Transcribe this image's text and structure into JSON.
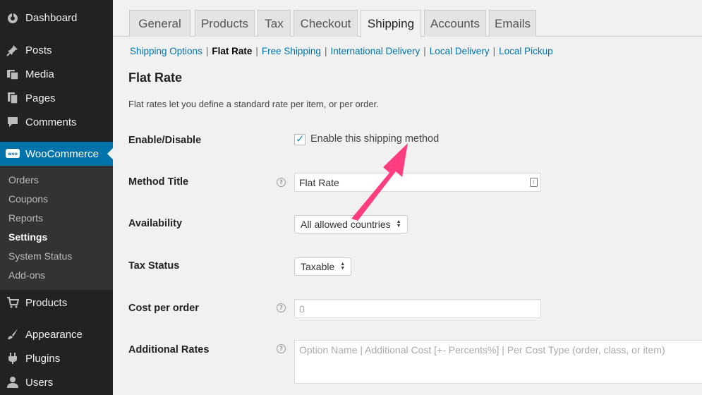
{
  "sidebar": {
    "items": [
      {
        "label": "Dashboard",
        "icon": "dashboard-icon"
      },
      {
        "label": "Posts",
        "icon": "pin-icon"
      },
      {
        "label": "Media",
        "icon": "media-icon"
      },
      {
        "label": "Pages",
        "icon": "pages-icon"
      },
      {
        "label": "Comments",
        "icon": "comments-icon"
      },
      {
        "label": "WooCommerce",
        "icon": "woo-icon"
      },
      {
        "label": "Products",
        "icon": "cart-icon"
      },
      {
        "label": "Appearance",
        "icon": "brush-icon"
      },
      {
        "label": "Plugins",
        "icon": "plug-icon"
      },
      {
        "label": "Users",
        "icon": "user-icon"
      }
    ],
    "submenu": [
      "Orders",
      "Coupons",
      "Reports",
      "Settings",
      "System Status",
      "Add-ons"
    ],
    "woo_badge": "woo"
  },
  "tabs": [
    "General",
    "Products",
    "Tax",
    "Checkout",
    "Shipping",
    "Accounts",
    "Emails"
  ],
  "subsub": [
    "Shipping Options",
    "Flat Rate",
    "Free Shipping",
    "International Delivery",
    "Local Delivery",
    "Local Pickup"
  ],
  "section": {
    "title": "Flat Rate",
    "description": "Flat rates let you define a standard rate per item, or per order."
  },
  "fields": {
    "enable_label": "Enable/Disable",
    "enable_checkbox_label": "Enable this shipping method",
    "method_title_label": "Method Title",
    "method_title_value": "Flat Rate",
    "availability_label": "Availability",
    "availability_value": "All allowed countries",
    "tax_status_label": "Tax Status",
    "tax_status_value": "Taxable",
    "cost_label": "Cost per order",
    "cost_placeholder": "0",
    "additional_rates_label": "Additional Rates",
    "additional_rates_placeholder": "Option Name | Additional Cost [+- Percents%] | Per Cost Type (order, class, or item)"
  },
  "colors": {
    "accent": "#0073aa",
    "annotation": "#ff3d7f",
    "sidebar_bg": "#222222"
  }
}
